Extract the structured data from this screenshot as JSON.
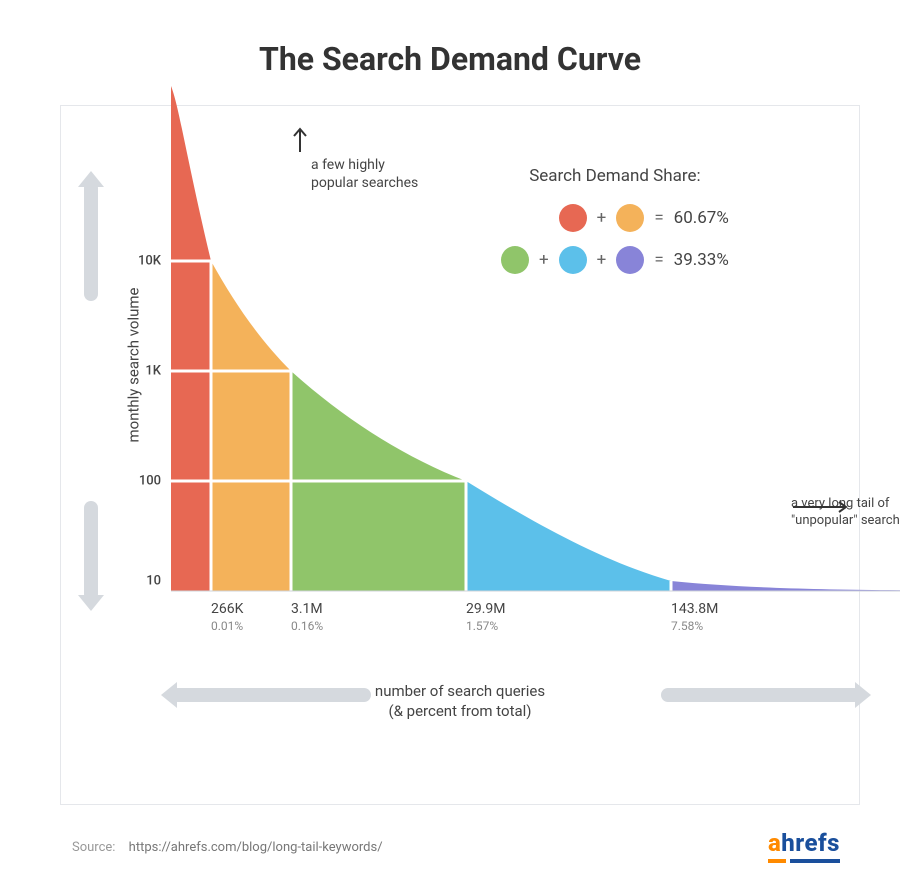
{
  "title": "The Search Demand Curve",
  "y_axis_label": "monthly search volume",
  "x_axis_label_line1": "number of search queries",
  "x_axis_label_line2": "(& percent from total)",
  "y_ticks": {
    "t10k": "10K",
    "t1k": "1K",
    "t100": "100",
    "t10": "10"
  },
  "x_ticks": {
    "t0": {
      "v": "266K",
      "p": "0.01%"
    },
    "t1": {
      "v": "3.1M",
      "p": "0.16%"
    },
    "t2": {
      "v": "29.9M",
      "p": "1.57%"
    },
    "t3": {
      "v": "143.8M",
      "p": "7.58%"
    }
  },
  "annotations": {
    "top_l1": "a few highly",
    "top_l2": "popular searches",
    "right_l1": "a very long tail of",
    "right_l2": "\"unpopular\" searches"
  },
  "legend": {
    "title": "Search Demand Share:",
    "row1_result": "60.67%",
    "row2_result": "39.33%",
    "plus": "+",
    "eq": "="
  },
  "colors": {
    "red": "#e76853",
    "orange": "#f4b25a",
    "green": "#90c56a",
    "blue": "#5cc0ea",
    "purple": "#8884d8"
  },
  "source_label": "Source:",
  "source_url": "https://ahrefs.com/blog/long-tail-keywords/",
  "brand_a": "a",
  "brand_b": "hrefs",
  "chart_data": {
    "type": "area",
    "title": "The Search Demand Curve",
    "xlabel": "number of search queries (& percent from total)",
    "ylabel": "monthly search volume",
    "y_scale": "log",
    "y_ticks": [
      10,
      100,
      1000,
      10000
    ],
    "segments": [
      {
        "color": "#e76853",
        "volume_min": 10000,
        "x_end_label": "266K",
        "x_end_pct": 0.01
      },
      {
        "color": "#f4b25a",
        "volume_min": 1000,
        "x_end_label": "3.1M",
        "x_end_pct": 0.16
      },
      {
        "color": "#90c56a",
        "volume_min": 100,
        "x_end_label": "29.9M",
        "x_end_pct": 1.57
      },
      {
        "color": "#5cc0ea",
        "volume_min": 10,
        "x_end_label": "143.8M",
        "x_end_pct": 7.58
      },
      {
        "color": "#8884d8",
        "volume_min": 0,
        "x_end_label": null,
        "x_end_pct": 100.0
      }
    ],
    "share_groups": [
      {
        "colors": [
          "#e76853",
          "#f4b25a"
        ],
        "share_pct": 60.67
      },
      {
        "colors": [
          "#90c56a",
          "#5cc0ea",
          "#8884d8"
        ],
        "share_pct": 39.33
      }
    ],
    "annotations": [
      "a few highly popular searches",
      "a very long tail of \"unpopular\" searches"
    ]
  }
}
